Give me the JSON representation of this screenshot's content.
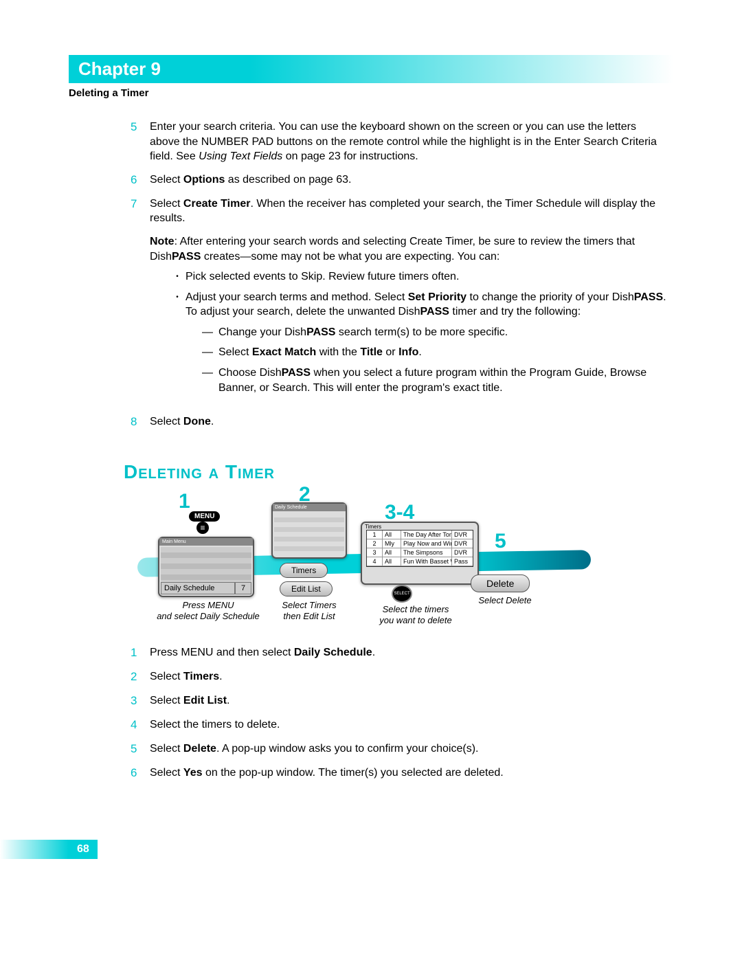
{
  "header": {
    "chapter": "Chapter 9",
    "section": "Deleting a Timer"
  },
  "steps_top": [
    {
      "num": "5",
      "parts": [
        "Enter your search criteria. You can use the keyboard shown on the screen or you can use the letters above the NUMBER PAD buttons on the remote control while the highlight is in the Enter Search Criteria field. See ",
        "Using Text Fields",
        " on page 23 for instructions."
      ]
    },
    {
      "num": "6",
      "parts": [
        "Select ",
        "Options",
        " as described on page 63."
      ]
    },
    {
      "num": "7",
      "parts": [
        "Select ",
        "Create Timer",
        ". When the receiver has completed your search, the Timer Schedule will display the results."
      ]
    }
  ],
  "note_block": {
    "lead": "Note",
    "text1": ": After entering your search words and selecting Create Timer, be sure to review the timers that Dish",
    "pass": "PASS",
    "text2": " creates—some may not be what you are expecting. You can:"
  },
  "note_bullets": [
    {
      "plain": "Pick selected events to Skip. Review future timers often."
    },
    {
      "plain_pre": "Adjust your search terms and method. Select ",
      "bold1": "Set Priority",
      "mid": " to change the priority of your Dish",
      "pass": "PASS",
      "post": ". To adjust your search, delete the unwanted Dish",
      "pass2": "PASS",
      "tail": " timer and try the following:"
    }
  ],
  "sub_bullets": [
    {
      "pre": "Change your Dish",
      "pass": "PASS",
      "post": " search term(s) to be more specific."
    },
    {
      "pre": "Select ",
      "b1": "Exact Match",
      "mid": " with the ",
      "b2": "Title",
      "mid2": " or ",
      "b3": "Info",
      "post": "."
    },
    {
      "pre": "Choose Dish",
      "pass": "PASS",
      "post": " when you select a future program within the Program Guide, Browse Banner, or Search. This will enter the program's exact title."
    }
  ],
  "step8": {
    "num": "8",
    "pre": "Select ",
    "bold": "Done",
    "post": "."
  },
  "heading": "Deleting a Timer",
  "diagram": {
    "menu_label": "MENU",
    "screen1_bottom": "Daily Schedule",
    "screen1_num": "7",
    "callout1": "1",
    "caption1_l1": "Press MENU",
    "caption1_l2": "and select Daily Schedule",
    "callout2": "2",
    "btn_timers": "Timers",
    "btn_editlist": "Edit List",
    "caption2_l1": "Select Timers",
    "caption2_l2": "then Edit List",
    "callout3": "3-4",
    "caption3_l1": "Select the timers",
    "caption3_l2": "you want to delete",
    "callout5": "5",
    "btn_delete": "Delete",
    "caption5": "Select Delete",
    "timers_title": "Timers",
    "timer_rows": [
      {
        "n": "1",
        "s": "All",
        "t": "The Day After Tomorrow",
        "k": "DVR"
      },
      {
        "n": "2",
        "s": "Mly",
        "t": "Play Now and Win...",
        "k": "DVR"
      },
      {
        "n": "3",
        "s": "All",
        "t": "The Simpsons",
        "k": "DVR"
      },
      {
        "n": "4",
        "s": "All",
        "t": "Fun With Basset Weaving",
        "k": "Pass"
      }
    ],
    "select_label": "SELECT"
  },
  "steps_bottom": [
    {
      "num": "1",
      "pre": "Press MENU and then select ",
      "bold": "Daily Schedule",
      "post": "."
    },
    {
      "num": "2",
      "pre": "Select ",
      "bold": "Timers",
      "post": "."
    },
    {
      "num": "3",
      "pre": "Select ",
      "bold": "Edit List",
      "post": "."
    },
    {
      "num": "4",
      "pre": "Select the timers to delete.",
      "bold": "",
      "post": ""
    },
    {
      "num": "5",
      "pre": "Select ",
      "bold": "Delete",
      "post": ". A pop-up window asks you to confirm your choice(s)."
    },
    {
      "num": "6",
      "pre": "Select ",
      "bold": "Yes",
      "post": " on the pop-up window. The timer(s) you selected are deleted."
    }
  ],
  "page_number": "68"
}
